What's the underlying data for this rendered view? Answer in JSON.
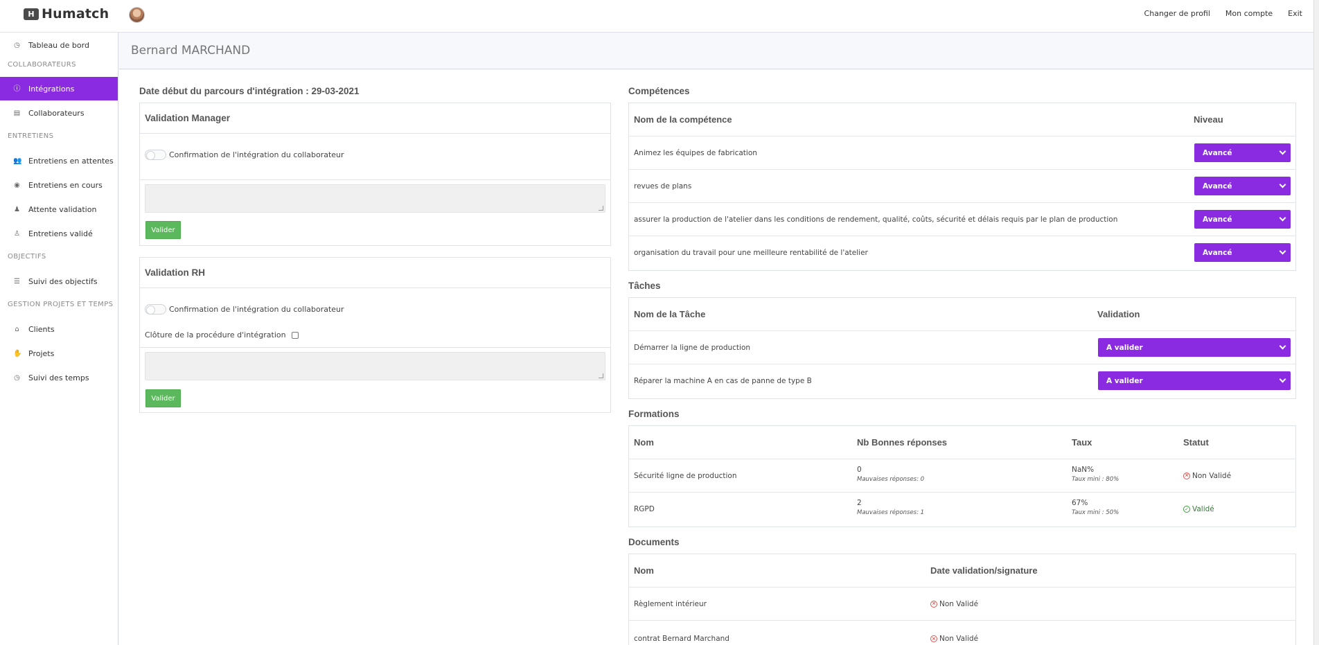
{
  "app": {
    "name": "Humatch",
    "logo_glyph": "H"
  },
  "topnav": [
    "Changer de profil",
    "Mon compte",
    "Exit"
  ],
  "sidebar": {
    "dashboard": "Tableau de bord",
    "groups": [
      {
        "heading": "COLLABORATEURS",
        "items": [
          "Intégrations",
          "Collaborateurs"
        ]
      },
      {
        "heading": "ENTRETIENS",
        "items": [
          "Entretiens en attentes",
          "Entretiens en cours",
          "Attente validation",
          "Entretiens validé"
        ]
      },
      {
        "heading": "OBJECTIFS",
        "items": [
          "Suivi des objectifs"
        ]
      },
      {
        "heading": "GESTION PROJETS ET TEMPS",
        "items": [
          "Clients",
          "Projets",
          "Suivi des temps"
        ]
      }
    ],
    "active_item": "Intégrations",
    "accent_color": "#8a2be2"
  },
  "page": {
    "title": "Bernard MARCHAND",
    "start_date_label": "Date début du parcours d'intégration : 29-03-2021"
  },
  "validation_manager": {
    "title": "Validation Manager",
    "toggle_label": "Confirmation de l'intégration du collaborateur",
    "button": "Valider"
  },
  "validation_rh": {
    "title": "Validation RH",
    "toggle_label": "Confirmation de l'intégration du collaborateur",
    "closure_label": "Clôture de la procédure d'intégration",
    "button": "Valider"
  },
  "competences": {
    "title": "Compétences",
    "headers": [
      "Nom de la compétence",
      "Niveau"
    ],
    "rows": [
      {
        "name": "Animez les équipes de fabrication",
        "level": "Avancé"
      },
      {
        "name": "revues de plans",
        "level": "Avancé"
      },
      {
        "name": "assurer la production de l'atelier dans les conditions de rendement, qualité, coûts, sécurité et délais requis par le plan de production",
        "level": "Avancé"
      },
      {
        "name": "organisation du travail pour une meilleure rentabilité de l'atelier",
        "level": "Avancé"
      }
    ]
  },
  "taches": {
    "title": "Tâches",
    "headers": [
      "Nom de la Tâche",
      "Validation"
    ],
    "rows": [
      {
        "name": "Démarrer la ligne de production",
        "validation": "A valider"
      },
      {
        "name": "Réparer la machine A en cas de panne de type B",
        "validation": "A valider"
      }
    ]
  },
  "formations": {
    "title": "Formations",
    "headers": [
      "Nom",
      "Nb Bonnes réponses",
      "Taux",
      "Statut"
    ],
    "rows": [
      {
        "name": "Sécurité ligne de production",
        "good": "0",
        "bad": "Mauvaises réponses: 0",
        "rate": "NaN%",
        "min": "Taux mini : 80%",
        "status": "Non Validé"
      },
      {
        "name": "RGPD",
        "good": "2",
        "bad": "Mauvaises réponses: 1",
        "rate": "67%",
        "min": "Taux mini : 50%",
        "status": "Validé"
      }
    ]
  },
  "documents": {
    "title": "Documents",
    "headers": [
      "Nom",
      "Date validation/signature"
    ],
    "rows": [
      {
        "name": "Règlement intérieur",
        "status": "Non Validé"
      },
      {
        "name": "contrat Bernard Marchand",
        "status": "Non Validé"
      }
    ]
  }
}
